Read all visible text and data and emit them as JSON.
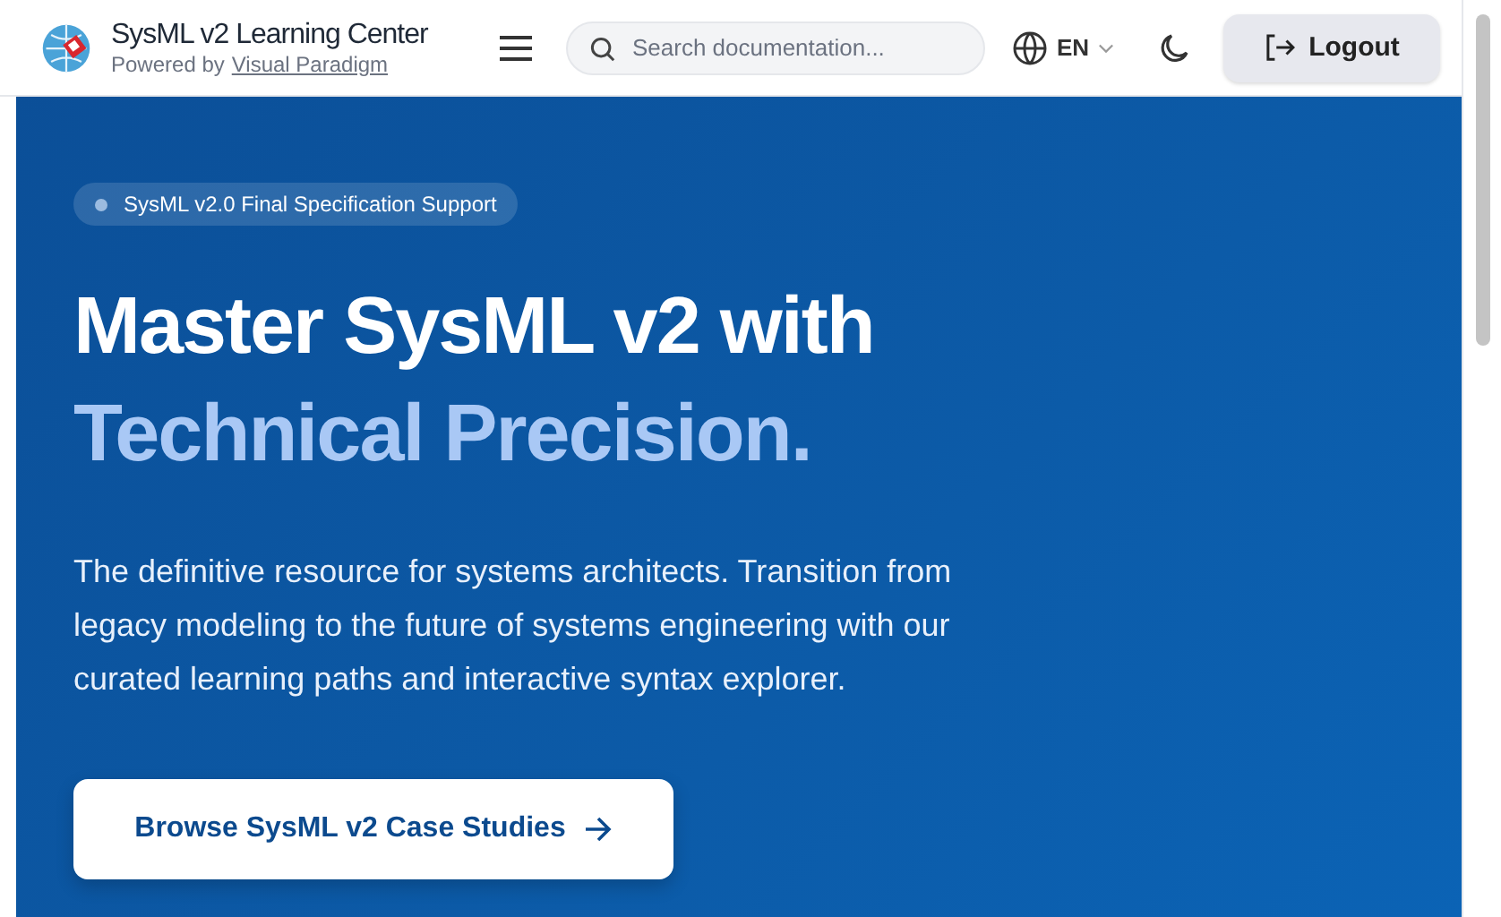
{
  "header": {
    "title": "SysML v2 Learning Center",
    "subtitle": "Powered by",
    "subtitle_link": "Visual Paradigm",
    "search": {
      "placeholder": "Search documentation..."
    },
    "language": "EN",
    "logout": "Logout"
  },
  "hero": {
    "badge": "SysML v2.0 Final Specification Support",
    "heading_line1": "Master SysML v2 with",
    "heading_line2": "Technical Precision.",
    "description": "The definitive resource for systems architects. Transition from legacy modeling to the future of systems engineering with our curated learning paths and interactive syntax explorer.",
    "cta": "Browse SysML v2 Case Studies"
  }
}
